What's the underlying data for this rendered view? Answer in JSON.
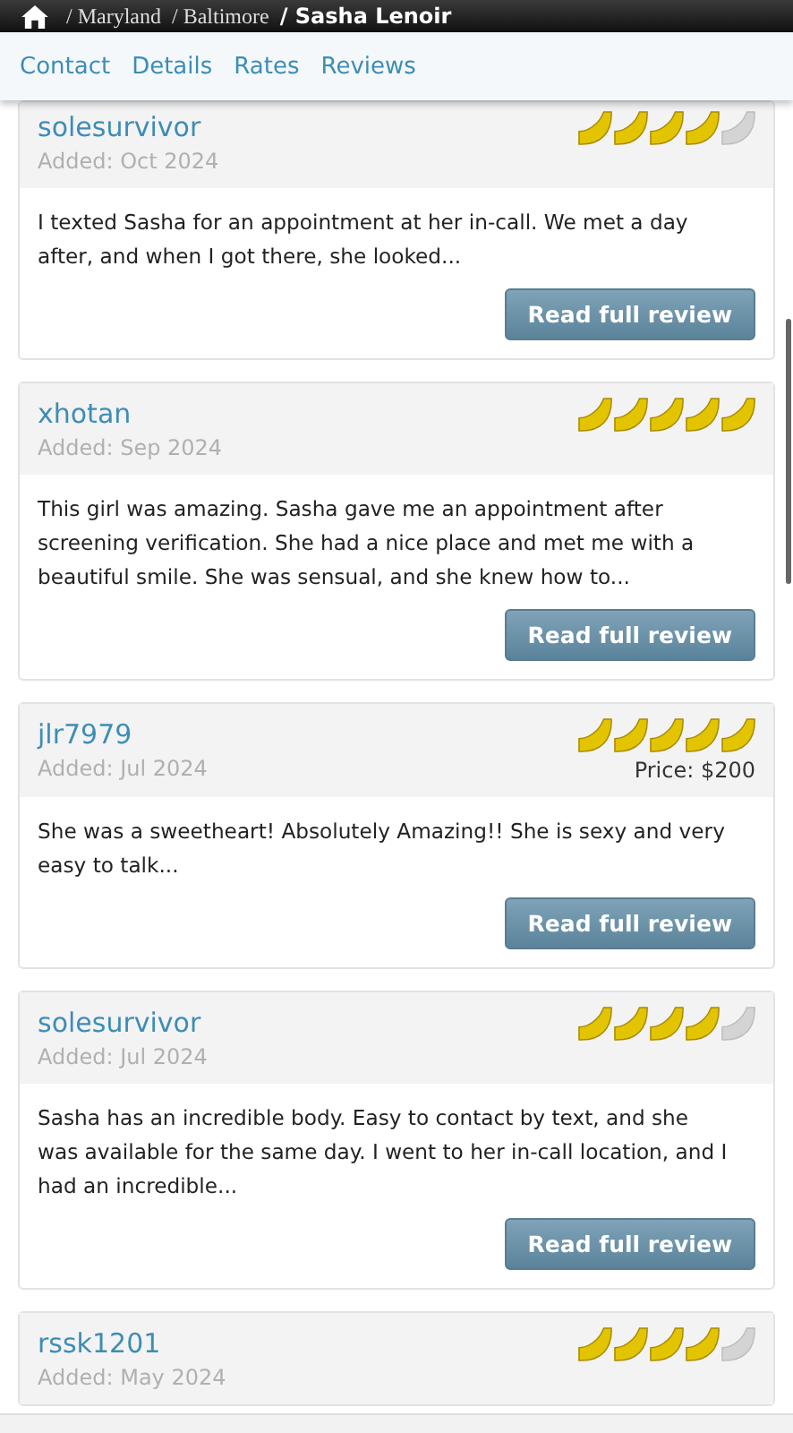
{
  "breadcrumb": {
    "items": [
      "/ Maryland",
      "/ Baltimore"
    ],
    "current": "/ Sasha Lenoir"
  },
  "tabs": [
    {
      "label": "Contact"
    },
    {
      "label": "Details"
    },
    {
      "label": "Rates"
    },
    {
      "label": "Reviews"
    }
  ],
  "reviews": [
    {
      "author": "solesurvivor",
      "added": "Added: Oct 2024",
      "stars": 4,
      "text": "I texted Sasha for an appointment at her in-call. We met a day after, and when I got there, she looked...",
      "button": "Read full review"
    },
    {
      "author": "xhotan",
      "added": "Added: Sep 2024",
      "stars": 5,
      "text": "This girl was amazing. Sasha gave me an appointment after screening verification. She had a nice place and met me with a beautiful smile. She was sensual, and she knew how to...",
      "button": "Read full review"
    },
    {
      "author": "jlr7979",
      "added": "Added: Jul 2024",
      "stars": 5,
      "price": "Price: $200",
      "text": "She was a sweetheart! Absolutely Amazing!! She is sexy and very easy to talk...",
      "button": "Read full review"
    },
    {
      "author": "solesurvivor",
      "added": "Added: Jul 2024",
      "stars": 4,
      "text": "Sasha has an incredible body. Easy to contact by text, and she was available for the same day. I went to her in-call location, and I had an incredible...",
      "button": "Read full review"
    },
    {
      "author": "rssk1201",
      "added": "Added: May 2024",
      "stars": 4
    }
  ]
}
